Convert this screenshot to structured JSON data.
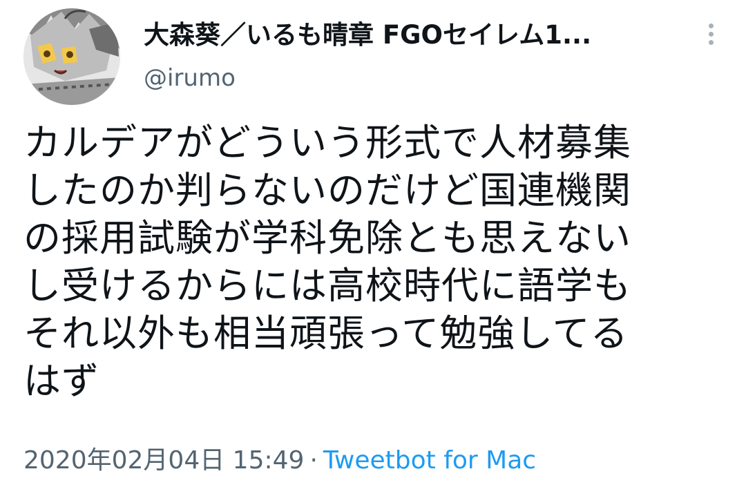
{
  "author": {
    "display_name": "大森葵／いるも晴章 FGOセイレム1...",
    "handle": "@irumo",
    "avatar_icon": "anime-character-avatar-icon"
  },
  "actions": {
    "more_icon": "more-vertical-icon"
  },
  "tweet": {
    "lines": [
      "カルデアがどういう形式で人材募集",
      "したのか判らないのだけど国連機関",
      "の採用試験が学科免除とも思えない",
      "し受けるからには高校時代に語学も",
      "それ以外も相当頑張って勉強してる",
      "はず"
    ]
  },
  "meta": {
    "timestamp": "2020年02月04日 15:49",
    "separator": "·",
    "client": "Tweetbot for Mac"
  },
  "colors": {
    "text": "#0f1419",
    "secondary": "#536471",
    "link": "#1d9bf0",
    "icon": "#a7b1ba"
  }
}
